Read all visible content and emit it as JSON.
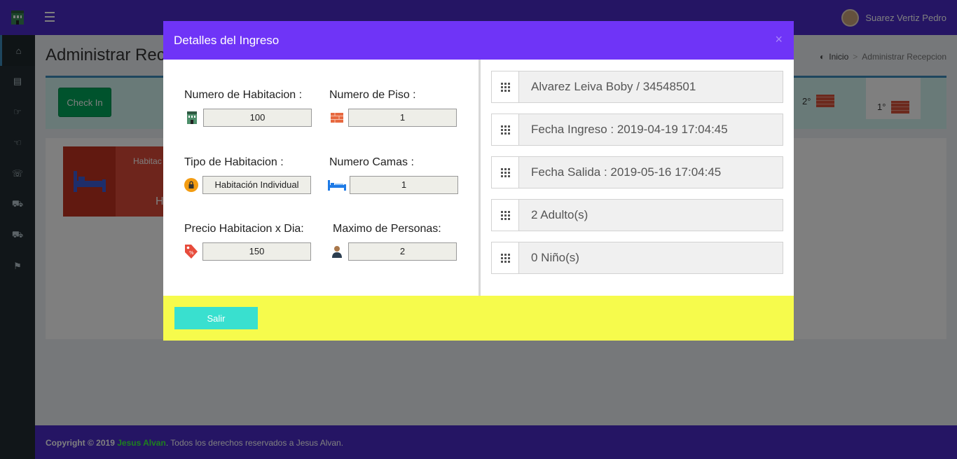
{
  "header": {
    "user_name": "Suarez Vertiz Pedro"
  },
  "page": {
    "title": "Administrar Recepcion",
    "breadcrumb_home": "Inicio",
    "breadcrumb_current": "Administrar Recepcion",
    "checkin_label": "Check In",
    "floors": [
      "2°",
      "1°"
    ],
    "room_card_label": "Habitac",
    "room_card_sub": "H"
  },
  "footer": {
    "copyright": "Copyright © 2019",
    "author": "Jesus Alvan",
    "rights": ". Todos los derechos reservados a Jesus Alvan."
  },
  "modal": {
    "title": "Detalles del Ingreso",
    "close_label": "×",
    "fields": {
      "room_number": {
        "label": "Numero de Habitacion :",
        "value": "100"
      },
      "floor_number": {
        "label": "Numero de Piso :",
        "value": "1"
      },
      "room_type": {
        "label": "Tipo de Habitacion :",
        "value": "Habitación Individual"
      },
      "beds": {
        "label": "Numero Camas :",
        "value": "1"
      },
      "price": {
        "label": "Precio Habitacion x Dia:",
        "value": "150"
      },
      "max_people": {
        "label": "Maximo de Personas:",
        "value": "2"
      }
    },
    "info": {
      "guest": "Alvarez Leiva Boby / 34548501",
      "checkin_date": "Fecha Ingreso : 2019-04-19 17:04:45",
      "checkout_date": "Fecha Salida : 2019-05-16 17:04:45",
      "adults": "2 Adulto(s)",
      "children": "0 Niño(s)"
    },
    "exit_label": "Salir"
  },
  "icons": {
    "sidebar": [
      "home-icon",
      "book-icon",
      "thumbs-up-icon",
      "hand-icon",
      "phone-icon",
      "cart-icon",
      "cart-icon",
      "bookmark-icon"
    ]
  },
  "colors": {
    "topbar": "#4a2bc9",
    "modal_header": "#6f34f7",
    "modal_footer": "#f6fb4c",
    "exit_button": "#39e0cf"
  }
}
